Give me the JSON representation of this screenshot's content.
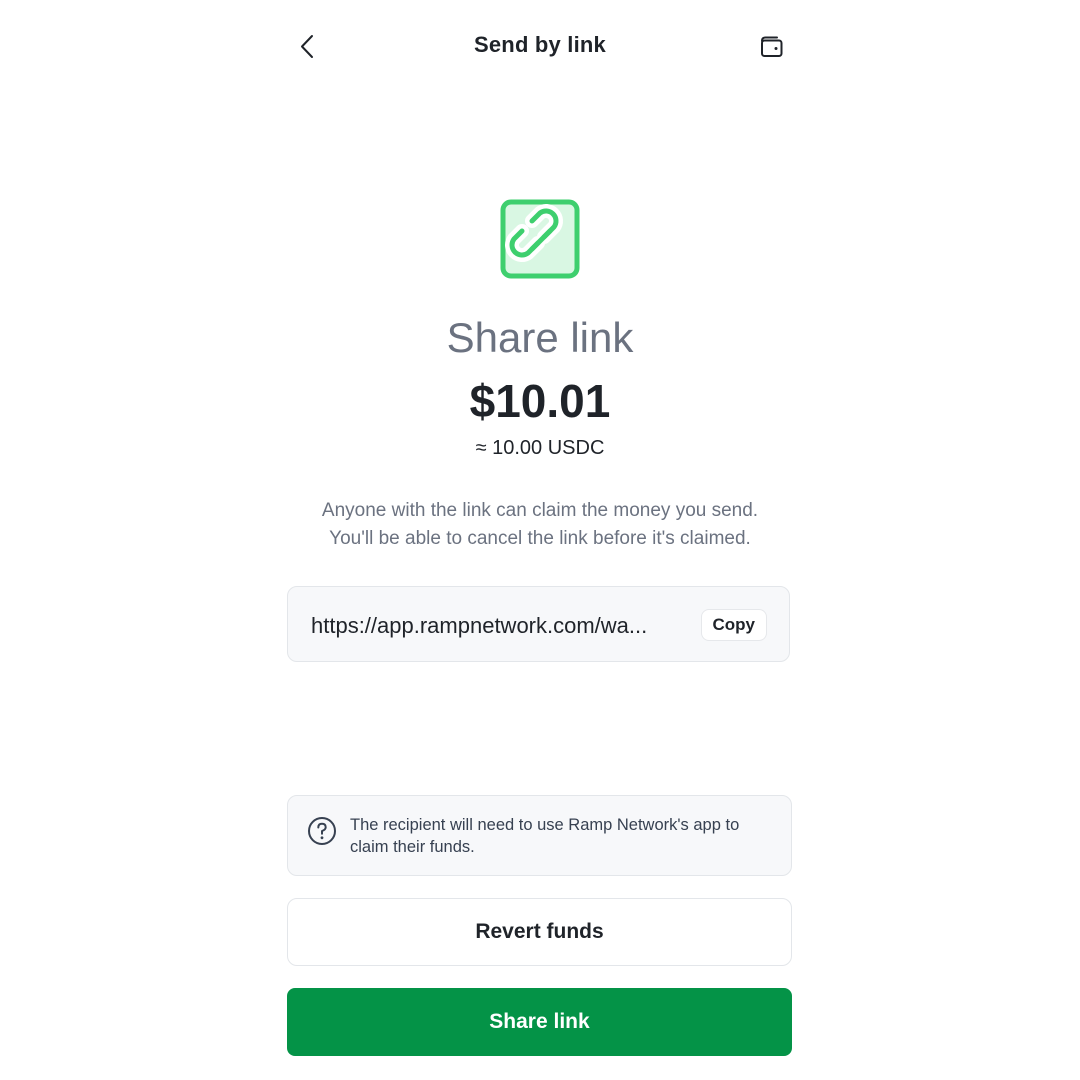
{
  "header": {
    "title": "Send by link",
    "back_icon": "chevron-left-icon",
    "wallet_icon": "wallet-icon"
  },
  "hero": {
    "icon": "link-icon",
    "title": "Share link",
    "amount": "$10.01",
    "crypto_amount": "≈ 10.00 USDC"
  },
  "description": {
    "line1": "Anyone with the link can claim the money you send.",
    "line2": "You'll be able to cancel the link before it's claimed."
  },
  "link": {
    "url": "https://app.rampnetwork.com/wa...",
    "copy_label": "Copy"
  },
  "info": {
    "icon": "help-circle-icon",
    "text": "The recipient will need to use Ramp Network's app to claim their funds."
  },
  "actions": {
    "revert_label": "Revert funds",
    "share_label": "Share link"
  },
  "colors": {
    "primary": "#049347",
    "icon_green": "#3ecf6e",
    "icon_fill": "#d9f7e3",
    "muted_text": "#6b7280"
  }
}
